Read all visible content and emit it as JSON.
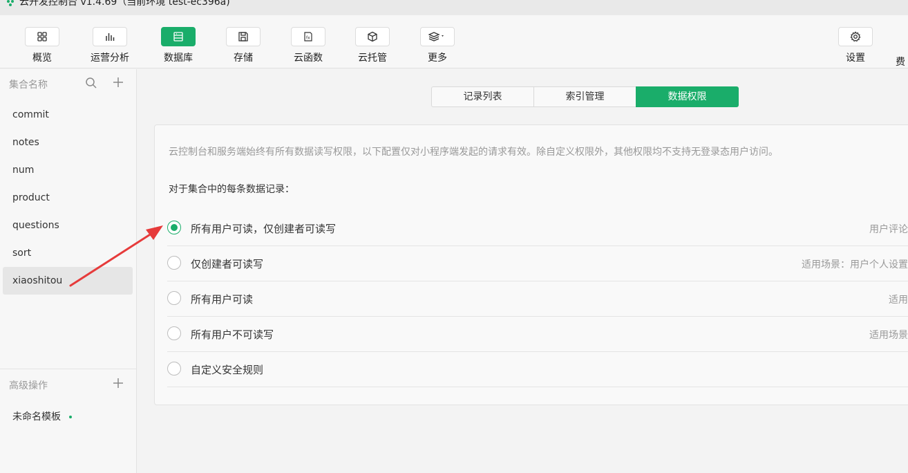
{
  "window": {
    "title": "云开发控制台 v1.4.69（当前环境 test-ec396a)"
  },
  "toolbar": {
    "items": [
      {
        "label": "概览",
        "icon": "grid-icon",
        "active": false
      },
      {
        "label": "运营分析",
        "icon": "bar-chart-icon",
        "active": false
      },
      {
        "label": "数据库",
        "icon": "database-icon",
        "active": true
      },
      {
        "label": "存储",
        "icon": "save-icon",
        "active": false
      },
      {
        "label": "云函数",
        "icon": "function-icon",
        "active": false
      },
      {
        "label": "云托管",
        "icon": "cube-icon",
        "active": false
      },
      {
        "label": "更多",
        "icon": "layers-icon",
        "active": false
      },
      {
        "label": "设置",
        "icon": "gear-icon",
        "active": false
      },
      {
        "label": "费",
        "icon": "",
        "active": false
      }
    ],
    "accent": "#1aad6a"
  },
  "sidebar": {
    "header": "集合名称",
    "collections": [
      "commit",
      "notes",
      "num",
      "product",
      "questions",
      "sort",
      "xiaoshitou"
    ],
    "selected": "xiaoshitou",
    "advanced_header": "高级操作",
    "template": "未命名模板"
  },
  "main": {
    "tabs": [
      "记录列表",
      "索引管理",
      "数据权限"
    ],
    "active_tab": "数据权限",
    "description": "云控制台和服务端始终有所有数据读写权限，以下配置仅对小程序端发起的请求有效。除自定义权限外，其他权限均不支持无登录态用户访问。",
    "subtitle": "对于集合中的每条数据记录：",
    "options": [
      {
        "label": "所有用户可读，仅创建者可读写",
        "hint": "用户评论",
        "checked": true
      },
      {
        "label": "仅创建者可读写",
        "hint": "适用场景：用户个人设置",
        "checked": false
      },
      {
        "label": "所有用户可读",
        "hint": "适用",
        "checked": false
      },
      {
        "label": "所有用户不可读写",
        "hint": "适用场景",
        "checked": false
      },
      {
        "label": "自定义安全规则",
        "hint": "",
        "checked": false
      }
    ]
  },
  "annotation_color": "#e63b3b"
}
